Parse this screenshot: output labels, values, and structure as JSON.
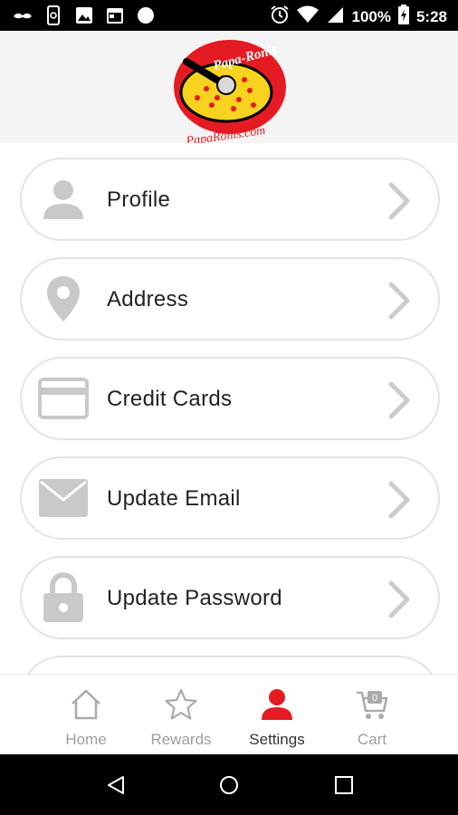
{
  "status_bar": {
    "battery": "100%",
    "time": "5:28"
  },
  "header": {
    "logo_text_top": "Papa-Ronis",
    "logo_text_bottom": "PapaRonis.com"
  },
  "settings_items": [
    {
      "label": "Profile",
      "icon": "person-icon"
    },
    {
      "label": "Address",
      "icon": "location-pin-icon"
    },
    {
      "label": "Credit Cards",
      "icon": "credit-card-icon"
    },
    {
      "label": "Update Email",
      "icon": "envelope-icon"
    },
    {
      "label": "Update Password",
      "icon": "lock-icon"
    }
  ],
  "bottom_nav": {
    "items": [
      {
        "label": "Home",
        "icon": "home-icon"
      },
      {
        "label": "Rewards",
        "icon": "star-icon"
      },
      {
        "label": "Settings",
        "icon": "person-icon",
        "active": true
      },
      {
        "label": "Cart",
        "icon": "cart-icon",
        "badge": "0"
      }
    ]
  },
  "colors": {
    "accent": "#e41b23",
    "icon_gray": "#c9c9c9",
    "chevron_gray": "#cccccc"
  }
}
